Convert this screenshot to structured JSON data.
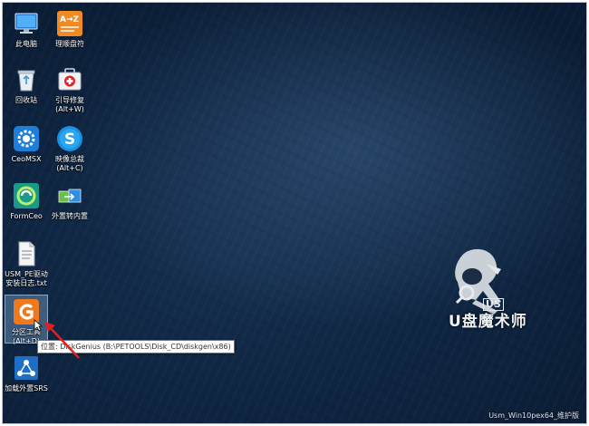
{
  "desktop": {
    "icons": [
      {
        "label_lines": [
          "此电脑"
        ],
        "icon": "computer-icon"
      },
      {
        "label_lines": [
          "理顺盘符"
        ],
        "icon": "az-sort-icon"
      },
      {
        "label_lines": [
          "回收站"
        ],
        "icon": "recycle-bin-icon"
      },
      {
        "label_lines": [
          "引导修复",
          "(Alt+W)"
        ],
        "icon": "first-aid-icon"
      },
      {
        "label_lines": [
          "CeoMSX"
        ],
        "icon": "gear-icon"
      },
      {
        "label_lines": [
          "映像总裁",
          "(Alt+C)"
        ],
        "icon": "s-logo-icon"
      },
      {
        "label_lines": [
          "FormCeo"
        ],
        "icon": "formceo-icon"
      },
      {
        "label_lines": [
          "外置转内置"
        ],
        "icon": "transfer-icon"
      },
      {
        "label_lines": [
          "USM_PE驱动",
          "安装日志.txt"
        ],
        "icon": "text-file-icon"
      },
      {
        "label_lines": [
          "分区工具",
          "(Alt+D)"
        ],
        "icon": "diskgenius-icon"
      },
      {
        "label_lines": [
          "加载外置SRS"
        ],
        "icon": "network-icon"
      }
    ],
    "tooltip": "位置: DiskGenius (B:\\PETOOLS\\Disk_CD\\diskgen\\x86)",
    "footer": "Usm_Win10pex64_维护版",
    "logo_text": "U盘魔术师",
    "logo_badge": "US"
  }
}
